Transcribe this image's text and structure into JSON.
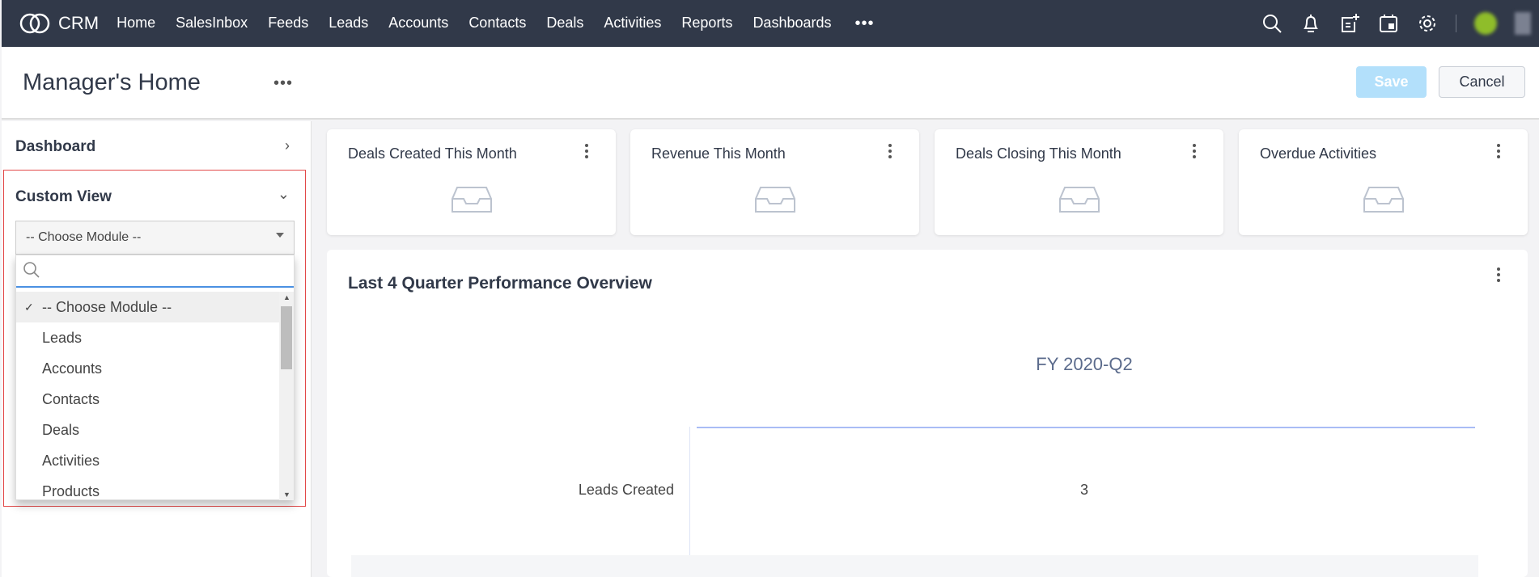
{
  "nav": {
    "brand": "CRM",
    "items": [
      "Home",
      "SalesInbox",
      "Feeds",
      "Leads",
      "Accounts",
      "Contacts",
      "Deals",
      "Activities",
      "Reports",
      "Dashboards"
    ],
    "more": "•••"
  },
  "header": {
    "title": "Manager's Home",
    "menu": "•••",
    "save": "Save",
    "cancel": "Cancel"
  },
  "sidebar": {
    "dashboard": "Dashboard",
    "custom_view": "Custom View",
    "select_value": "-- Choose Module --",
    "search_placeholder": "",
    "options": [
      "-- Choose Module --",
      "Leads",
      "Accounts",
      "Contacts",
      "Deals",
      "Activities",
      "Products"
    ],
    "selected_index": 0
  },
  "cards": [
    "Deals Created This Month",
    "Revenue This Month",
    "Deals Closing This Month",
    "Overdue Activities"
  ],
  "panel": {
    "title": "Last 4 Quarter Performance Overview",
    "period": "FY 2020-Q2",
    "row_label": "Leads Created",
    "row_value": "3"
  },
  "colors": {
    "nav_bg": "#313949",
    "save_bg": "#b3e0fb",
    "highlight_border": "#e24848"
  }
}
